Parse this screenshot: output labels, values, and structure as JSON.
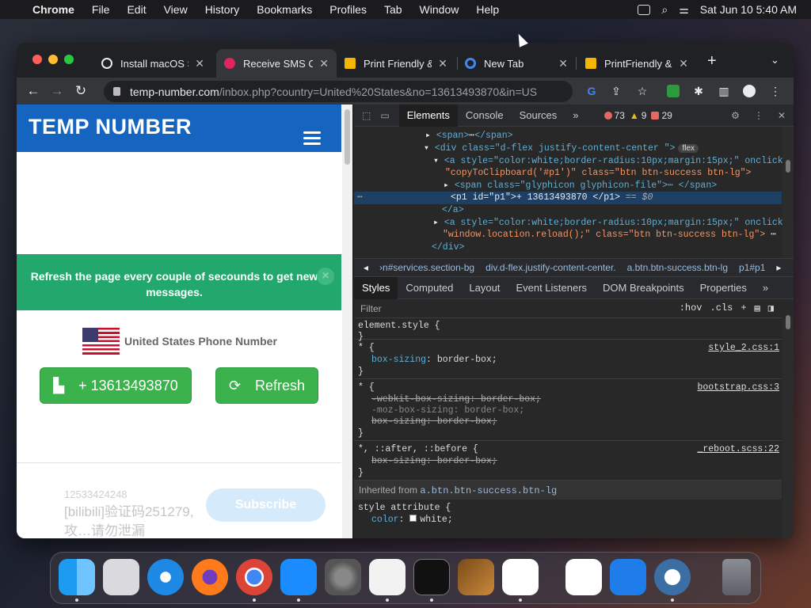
{
  "menubar": {
    "apple": "",
    "app_name": "Chrome",
    "items": [
      "File",
      "Edit",
      "View",
      "History",
      "Bookmarks",
      "Profiles",
      "Tab",
      "Window",
      "Help"
    ],
    "clock": "Sat Jun 10  5:40 AM"
  },
  "tabs": [
    {
      "title": "Install macOS S",
      "favicon_color": "#e8eaed"
    },
    {
      "title": "Receive SMS O",
      "favicon_color": "#e0245e"
    },
    {
      "title": "Print Friendly &",
      "favicon_color": "#f4b400"
    },
    {
      "title": "New Tab",
      "favicon_color": "#4285f4"
    },
    {
      "title": "PrintFriendly &",
      "favicon_color": "#f4b400"
    }
  ],
  "address": {
    "host": "temp-number.com",
    "path": "/inbox.php?country=United%20States&no=13613493870&in=US"
  },
  "site": {
    "logo": "TEMP NUMBER",
    "alert": "Refresh the page every couple of secounds to get new messages.",
    "alert_close": "×",
    "country_label": "United States Phone Number",
    "number_button": "+ 13613493870",
    "refresh_button": "Refresh",
    "message_from": "12533424248",
    "message_text": "[bilibili]验证码251279, 攻…请勿泄漏",
    "subscribe": "Subscribe"
  },
  "devtools": {
    "tabs": [
      "Elements",
      "Console",
      "Sources",
      "»"
    ],
    "errors": "73",
    "warnings": "9",
    "issues": "29",
    "dom_lines": {
      "l1_open": "<span>",
      "l1_ellipsis": "⋯",
      "l1_close": "</span>",
      "l2": "<div class=\"d-flex justify-content-center \">",
      "l2_badge": "flex",
      "l3": "<a style=\"color:white;border-radius:10px;margin:15px;\" onclick=",
      "l4": "\"copyToClipboard('#p1')\" class=\"btn btn-success btn-lg\">",
      "l5": "<span class=\"glyphicon glyphicon-file\">",
      "l5_end": "⋯ </span>",
      "l6": "<p1 id=\"p1\">+ 13613493870 </p1>",
      "l6_eq": "== $0",
      "l7": "</a>",
      "l8": "<a style=\"color:white;border-radius:10px;margin:15px;\" onclick=",
      "l9": "\"window.location.reload();\" class=\"btn btn-success btn-lg\">",
      "l9_end": "⋯",
      "l10": "</div>"
    },
    "breadcrumbs": [
      "◂",
      "›n#services.section-bg",
      "div.d-flex.justify-content-center.",
      "a.btn.btn-success.btn-lg",
      "p1#p1",
      "▸"
    ],
    "style_tabs": [
      "Styles",
      "Computed",
      "Layout",
      "Event Listeners",
      "DOM Breakpoints",
      "Properties",
      "»"
    ],
    "filter_placeholder": "Filter",
    "filter_hov": ":hov",
    "filter_cls": ".cls",
    "rules": {
      "r0_sel": "element.style {",
      "r0_end": "}",
      "r1_sel": "* {",
      "r1_src": "style_2.css:1",
      "r1_prop": "box-sizing",
      "r1_val": ": border-box;",
      "r1_end": "}",
      "r2_sel": "* {",
      "r2_src": "bootstrap.css:3",
      "r2_p1": "-webkit-box-sizing: border-box;",
      "r2_p2": "-moz-box-sizing: border-box;",
      "r2_p3": "box-sizing: border-box;",
      "r2_end": "}",
      "r3_sel": "*, ::after, ::before {",
      "r3_src": "_reboot.scss:22",
      "r3_p1": "box-sizing: border-box;",
      "r3_end": "}",
      "inherited": "Inherited from",
      "inherited_sel": "a.btn.btn-success.btn-lg",
      "r4_sel": "style attribute {",
      "r4_prop": "color",
      "r4_val": "white;"
    }
  },
  "dock": [
    "Finder",
    "Launchpad",
    "Safari",
    "Firefox",
    "Chrome",
    "App Store",
    "System Preferences",
    "TextEdit",
    "Terminal",
    "Instruments",
    "Visual Studio Code",
    "Visual Studio",
    "Keynote",
    "QuickTime Player",
    "Trash"
  ]
}
